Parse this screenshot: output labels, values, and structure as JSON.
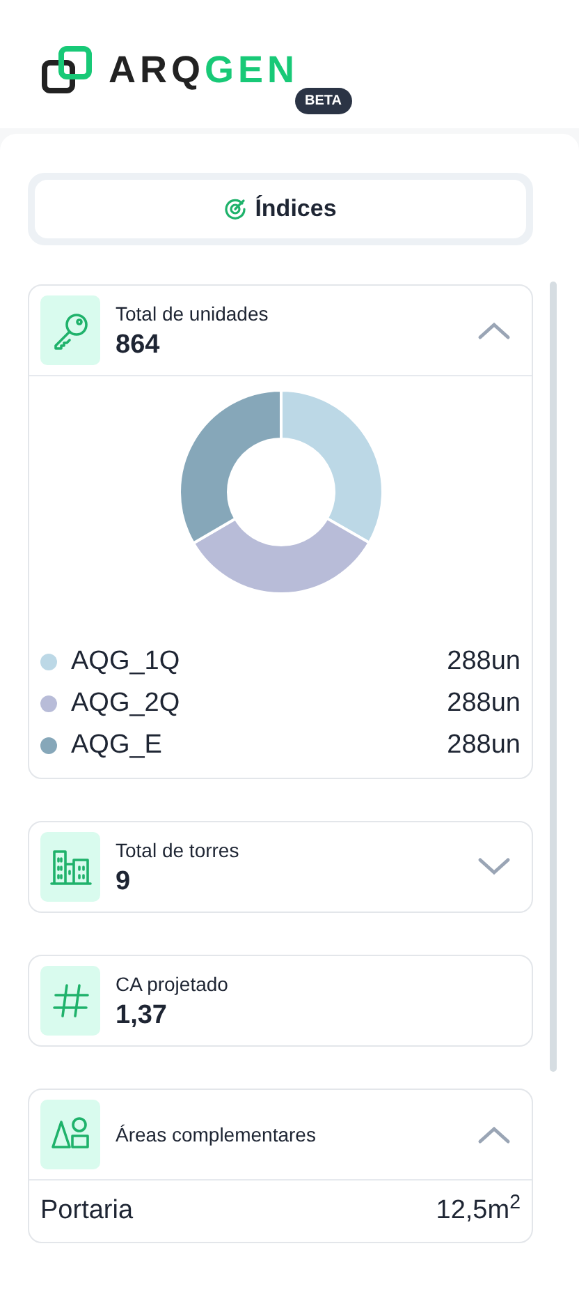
{
  "logo": {
    "word_dark": "ARQ",
    "word_green": "GEN",
    "badge": "BETA"
  },
  "tabs": [
    {
      "label": "Índices",
      "selected": true
    }
  ],
  "cards": [
    {
      "title": "Total de unidades",
      "value": "864",
      "expanded": true,
      "body": {
        "kind": "chart",
        "chart_data": {
          "type": "donut",
          "categories": [
            "AQG_1Q",
            "AQG_2Q",
            "AQG_E"
          ],
          "series": [
            {
              "values": [
                33.3,
                33.3,
                33.4
              ]
            }
          ]
        },
        "legend": [
          {
            "value": "288un",
            "color": "#bcd8e6"
          },
          {
            "value": "288un",
            "color": "#b8bcd8"
          },
          {
            "value": "288un",
            "color": "#86a7b9"
          }
        ]
      }
    },
    {
      "title": "Total de torres",
      "value": "9",
      "expanded": false
    },
    {
      "title": "CA projetado",
      "value": "1,37"
    },
    {
      "title": "Áreas complementares",
      "expanded": true,
      "body": {
        "kind": "list",
        "rows": [
          {
            "label": "Portaria",
            "value": "12,5m$^{2}$"
          }
        ]
      }
    }
  ]
}
